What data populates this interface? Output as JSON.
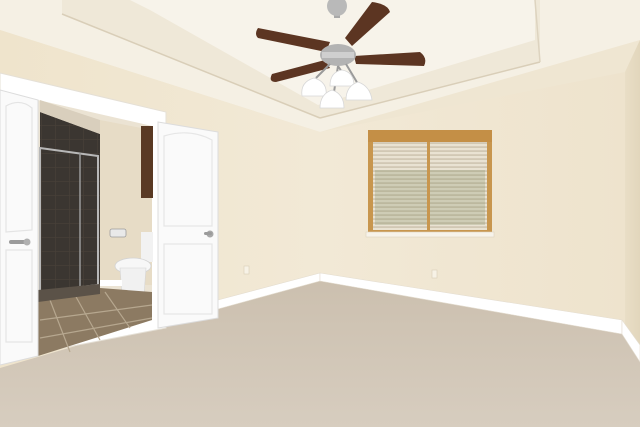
{
  "scene": {
    "description_tags": [
      "ceiling-fan",
      "tray-ceiling",
      "window-blinds",
      "open-double-doors",
      "ensuite-bathroom",
      "carpet-floor"
    ],
    "colors": {
      "wall": "#efe5d0",
      "wall_right": "#ebe0c8",
      "ceiling": "#f6f2e8",
      "tray_face": "#efe8da",
      "carpet": "#cfc5b6",
      "baseboard": "#ffffff",
      "door": "#fafafa",
      "door_trim": "#f4f4f2",
      "window_frame": "#c8964e",
      "shower_tile": "#3e3a36",
      "bath_floor": "#8c7a62",
      "fan_blade": "#5c3522",
      "fan_metal": "#b9b9b9",
      "fan_light": "#ffffff"
    }
  }
}
